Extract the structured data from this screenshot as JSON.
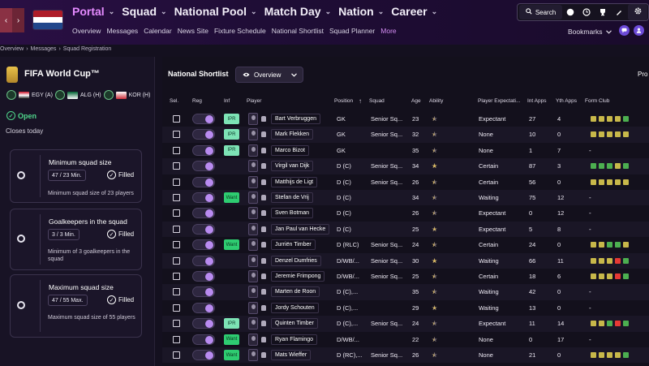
{
  "header": {
    "back_glyph": "‹",
    "forward_glyph": "›",
    "flag_colors": [
      "#ae1c28",
      "#ffffff",
      "#21468b"
    ],
    "main_nav": [
      {
        "label": "Portal",
        "active": true
      },
      {
        "label": "Squad",
        "active": false
      },
      {
        "label": "National Pool",
        "active": false
      },
      {
        "label": "Match Day",
        "active": false
      },
      {
        "label": "Nation",
        "active": false
      },
      {
        "label": "Career",
        "active": false
      }
    ],
    "sub_nav": [
      {
        "label": "Overview",
        "active": false
      },
      {
        "label": "Messages",
        "active": false
      },
      {
        "label": "Calendar",
        "active": false
      },
      {
        "label": "News Site",
        "active": false
      },
      {
        "label": "Fixture Schedule",
        "active": false
      },
      {
        "label": "National Shortlist",
        "active": false
      },
      {
        "label": "Squad Planner",
        "active": false
      },
      {
        "label": "More",
        "active": true
      }
    ],
    "search_label": "Search",
    "bookmarks_label": "Bookmarks"
  },
  "breadcrumb": [
    "Overview",
    "Messages",
    "Squad Registration"
  ],
  "competition": {
    "title": "FIFA World Cup™",
    "groups": [
      {
        "code": "EGY (A)",
        "colors": [
          "#ce1126",
          "#ffffff",
          "#000000"
        ]
      },
      {
        "code": "ALG (H)",
        "colors": [
          "#006233",
          "#ffffff"
        ]
      },
      {
        "code": "KOR (H)",
        "colors": [
          "#ffffff",
          "#cd2e3a"
        ]
      }
    ],
    "status": "Open",
    "closes": "Closes today"
  },
  "rules": [
    {
      "title": "Minimum squad size",
      "count": "47 / 23 Min.",
      "state": "Filled",
      "desc": "Minimum squad size of 23 players"
    },
    {
      "title": "Goalkeepers in the squad",
      "count": "3 / 3 Min.",
      "state": "Filled",
      "desc": "Minimum of 3 goalkeepers in the squad"
    },
    {
      "title": "Maximum squad size",
      "count": "47 / 55 Max.",
      "state": "Filled",
      "desc": "Maximum squad size of 55 players"
    }
  ],
  "shortlist": {
    "title": "National Shortlist",
    "view": "Overview",
    "right_cut": "Pro",
    "columns": [
      "Sel.",
      "Reg",
      "Inf",
      "Player",
      "Position",
      "Squad",
      "Age",
      "Ability",
      "Player Expectati...",
      "Int Apps",
      "Yth Apps",
      "Form Club"
    ],
    "sort_glyph": "↑",
    "form_colors": {
      "g": "#4caf50",
      "y": "#c8b84a",
      "r": "#e53935"
    },
    "players": [
      {
        "inf": "IPR",
        "name": "Bart Verbruggen",
        "pos": "GK",
        "squad": "Senior Sq...",
        "age": "23",
        "stars": 2.5,
        "exp": "Expectant",
        "int": "27",
        "yth": "4",
        "form": "yyyyg"
      },
      {
        "inf": "IPR",
        "name": "Mark Flekken",
        "pos": "GK",
        "squad": "Senior Sq...",
        "age": "32",
        "stars": 2.5,
        "exp": "None",
        "int": "10",
        "yth": "0",
        "form": "yyyyy"
      },
      {
        "inf": "IPR",
        "name": "Marco Bizot",
        "pos": "GK",
        "squad": "",
        "age": "35",
        "stars": 2.5,
        "exp": "None",
        "int": "1",
        "yth": "7",
        "form": ""
      },
      {
        "inf": "",
        "name": "Virgil van Dijk",
        "pos": "D (C)",
        "squad": "Senior Sq...",
        "age": "34",
        "stars": 4,
        "exp": "Certain",
        "int": "87",
        "yth": "3",
        "form": "gggyg"
      },
      {
        "inf": "",
        "name": "Matthijs de Ligt",
        "pos": "D (C)",
        "squad": "Senior Sq...",
        "age": "26",
        "stars": 3.5,
        "exp": "Certain",
        "int": "56",
        "yth": "0",
        "form": "yyyyy"
      },
      {
        "inf": "Want",
        "name": "Stefan de Vrij",
        "pos": "D (C)",
        "squad": "",
        "age": "34",
        "stars": 2.5,
        "exp": "Waiting",
        "int": "75",
        "yth": "12",
        "form": ""
      },
      {
        "inf": "",
        "name": "Sven Botman",
        "pos": "D (C)",
        "squad": "",
        "age": "26",
        "stars": 2.5,
        "exp": "Expectant",
        "int": "0",
        "yth": "12",
        "form": ""
      },
      {
        "inf": "",
        "name": "Jan Paul van Hecke",
        "pos": "D (C)",
        "squad": "",
        "age": "25",
        "stars": 3,
        "exp": "Expectant",
        "int": "5",
        "yth": "8",
        "form": ""
      },
      {
        "inf": "Want",
        "name": "Jurriën Timber",
        "pos": "D (RLC)",
        "squad": "Senior Sq...",
        "age": "24",
        "stars": 3.5,
        "exp": "Certain",
        "int": "24",
        "yth": "0",
        "form": "yyggy"
      },
      {
        "inf": "",
        "name": "Denzel Dumfries",
        "pos": "D/WB/...",
        "squad": "Senior Sq...",
        "age": "30",
        "stars": 4,
        "exp": "Waiting",
        "int": "66",
        "yth": "11",
        "form": "yyyrg"
      },
      {
        "inf": "",
        "name": "Jeremie Frimpong",
        "pos": "D/WB/...",
        "squad": "Senior Sq...",
        "age": "25",
        "stars": 3.5,
        "exp": "Certain",
        "int": "18",
        "yth": "6",
        "form": "yyyrg"
      },
      {
        "inf": "",
        "name": "Marten de Roon",
        "pos": "D (C),...",
        "squad": "",
        "age": "35",
        "stars": 3.5,
        "exp": "Waiting",
        "int": "42",
        "yth": "0",
        "form": ""
      },
      {
        "inf": "",
        "name": "Jordy Schouten",
        "pos": "D (C),...",
        "squad": "",
        "age": "29",
        "stars": 3,
        "exp": "Waiting",
        "int": "13",
        "yth": "0",
        "form": ""
      },
      {
        "inf": "IPR",
        "name": "Quinten Timber",
        "pos": "D (C),...",
        "squad": "Senior Sq...",
        "age": "24",
        "stars": 2.5,
        "exp": "Expectant",
        "int": "11",
        "yth": "14",
        "form": "yygrg"
      },
      {
        "inf": "Want",
        "name": "Ryan Flamingo",
        "pos": "D/WB/...",
        "squad": "",
        "age": "22",
        "stars": 2.5,
        "exp": "None",
        "int": "0",
        "yth": "17",
        "form": ""
      },
      {
        "inf": "Want",
        "name": "Mats Wieffer",
        "pos": "D (RC),...",
        "squad": "Senior Sq...",
        "age": "26",
        "stars": 2.5,
        "exp": "None",
        "int": "21",
        "yth": "0",
        "form": "yyyyg"
      }
    ]
  }
}
